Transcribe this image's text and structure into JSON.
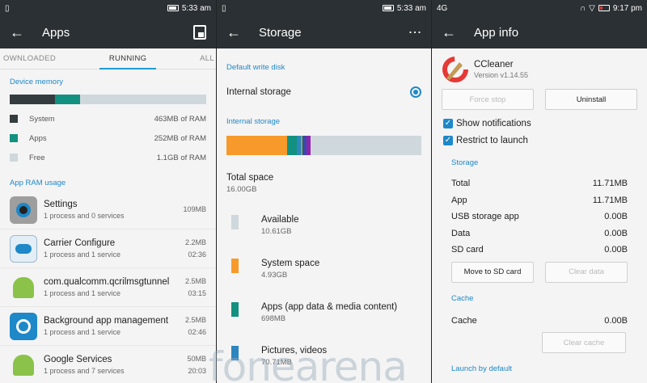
{
  "colors": {
    "accent": "#1e88c8",
    "dark": "#2b3034",
    "orange": "#f89a2b",
    "teal": "#129180",
    "grey": "#cfd8dc",
    "ramgrey": "#353c40"
  },
  "panel1": {
    "time": "5:33 am",
    "title": "Apps",
    "tabs": [
      "OWNLOADED",
      "RUNNING",
      "ALL"
    ],
    "device_memory_title": "Device memory",
    "memory_fractions": {
      "system": 0.23,
      "apps": 0.13,
      "free": 0.64
    },
    "legend": [
      {
        "label": "System",
        "value": "463MB of RAM",
        "color": "#353c40"
      },
      {
        "label": "Apps",
        "value": "252MB of RAM",
        "color": "#129180"
      },
      {
        "label": "Free",
        "value": "1.1GB of RAM",
        "color": "#cfd8dc"
      }
    ],
    "app_ram_title": "App RAM usage",
    "apps": [
      {
        "name": "Settings",
        "sub": "1 process and 0 services",
        "size": "109MB",
        "time": "",
        "icon": "settings-icon"
      },
      {
        "name": "Carrier Configure",
        "sub": "1 process and 1 service",
        "size": "2.2MB",
        "time": "02:36",
        "icon": "carrier-configure-icon"
      },
      {
        "name": "com.qualcomm.qcrilmsgtunnel",
        "sub": "1 process and 1 service",
        "size": "2.5MB",
        "time": "03:15",
        "icon": "android-icon"
      },
      {
        "name": "Background app management",
        "sub": "1 process and 1 service",
        "size": "2.5MB",
        "time": "02:46",
        "icon": "background-app-icon"
      },
      {
        "name": "Google Services",
        "sub": "1 process and 7 services",
        "size": "50MB",
        "time": "20:03",
        "icon": "android-icon"
      }
    ]
  },
  "panel2": {
    "time": "5:33 am",
    "title": "Storage",
    "menu": "⋮",
    "default_write_title": "Default write disk",
    "internal_storage_option": "Internal storage",
    "internal_storage_title": "Internal storage",
    "bar_segments": [
      {
        "name": "system",
        "fraction": 0.31,
        "color": "#f89a2b"
      },
      {
        "name": "apps",
        "fraction": 0.05,
        "color": "#129180"
      },
      {
        "name": "pictures",
        "fraction": 0.02,
        "color": "#2e86c1"
      },
      {
        "name": "other1",
        "fraction": 0.01,
        "color": "#7cb342"
      },
      {
        "name": "other2",
        "fraction": 0.02,
        "color": "#3949ab"
      },
      {
        "name": "other3",
        "fraction": 0.02,
        "color": "#8e24aa"
      }
    ],
    "total_label": "Total space",
    "total_value": "16.00GB",
    "rows": [
      {
        "label": "Available",
        "value": "10.61GB",
        "color": "#cfd8dc"
      },
      {
        "label": "System space",
        "value": "4.93GB",
        "color": "#f89a2b"
      },
      {
        "label": "Apps (app data & media content)",
        "value": "698MB",
        "color": "#129180"
      },
      {
        "label": "Pictures, videos",
        "value": "70.71MB",
        "color": "#2e86c1"
      }
    ]
  },
  "panel3": {
    "status_left": "4G",
    "time": "9:17 pm",
    "title": "App info",
    "app_name": "CCleaner",
    "version": "Version v1.14.55",
    "force_stop": "Force stop",
    "uninstall": "Uninstall",
    "show_notifications": "Show notifications",
    "restrict_launch": "Restrict to launch",
    "storage_title": "Storage",
    "storage_rows": [
      {
        "label": "Total",
        "value": "11.71MB"
      },
      {
        "label": "App",
        "value": "11.71MB"
      },
      {
        "label": "USB storage app",
        "value": "0.00B"
      },
      {
        "label": "Data",
        "value": "0.00B"
      },
      {
        "label": "SD card",
        "value": "0.00B"
      }
    ],
    "move_sd": "Move to SD card",
    "clear_data": "Clear data",
    "cache_title": "Cache",
    "cache_label": "Cache",
    "cache_value": "0.00B",
    "clear_cache": "Clear cache",
    "launch_default": "Launch by default"
  },
  "watermark": "fonearena"
}
